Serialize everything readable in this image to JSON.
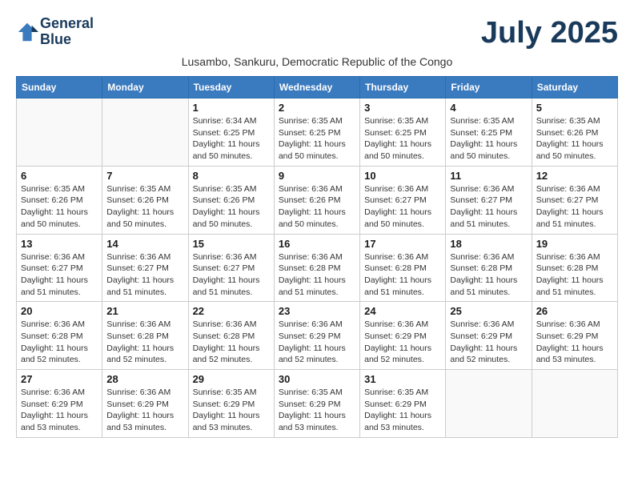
{
  "header": {
    "logo_line1": "General",
    "logo_line2": "Blue",
    "month_title": "July 2025",
    "subtitle": "Lusambo, Sankuru, Democratic Republic of the Congo"
  },
  "weekdays": [
    "Sunday",
    "Monday",
    "Tuesday",
    "Wednesday",
    "Thursday",
    "Friday",
    "Saturday"
  ],
  "weeks": [
    [
      {
        "day": "",
        "info": ""
      },
      {
        "day": "",
        "info": ""
      },
      {
        "day": "1",
        "info": "Sunrise: 6:34 AM\nSunset: 6:25 PM\nDaylight: 11 hours and 50 minutes."
      },
      {
        "day": "2",
        "info": "Sunrise: 6:35 AM\nSunset: 6:25 PM\nDaylight: 11 hours and 50 minutes."
      },
      {
        "day": "3",
        "info": "Sunrise: 6:35 AM\nSunset: 6:25 PM\nDaylight: 11 hours and 50 minutes."
      },
      {
        "day": "4",
        "info": "Sunrise: 6:35 AM\nSunset: 6:25 PM\nDaylight: 11 hours and 50 minutes."
      },
      {
        "day": "5",
        "info": "Sunrise: 6:35 AM\nSunset: 6:26 PM\nDaylight: 11 hours and 50 minutes."
      }
    ],
    [
      {
        "day": "6",
        "info": "Sunrise: 6:35 AM\nSunset: 6:26 PM\nDaylight: 11 hours and 50 minutes."
      },
      {
        "day": "7",
        "info": "Sunrise: 6:35 AM\nSunset: 6:26 PM\nDaylight: 11 hours and 50 minutes."
      },
      {
        "day": "8",
        "info": "Sunrise: 6:35 AM\nSunset: 6:26 PM\nDaylight: 11 hours and 50 minutes."
      },
      {
        "day": "9",
        "info": "Sunrise: 6:36 AM\nSunset: 6:26 PM\nDaylight: 11 hours and 50 minutes."
      },
      {
        "day": "10",
        "info": "Sunrise: 6:36 AM\nSunset: 6:27 PM\nDaylight: 11 hours and 50 minutes."
      },
      {
        "day": "11",
        "info": "Sunrise: 6:36 AM\nSunset: 6:27 PM\nDaylight: 11 hours and 51 minutes."
      },
      {
        "day": "12",
        "info": "Sunrise: 6:36 AM\nSunset: 6:27 PM\nDaylight: 11 hours and 51 minutes."
      }
    ],
    [
      {
        "day": "13",
        "info": "Sunrise: 6:36 AM\nSunset: 6:27 PM\nDaylight: 11 hours and 51 minutes."
      },
      {
        "day": "14",
        "info": "Sunrise: 6:36 AM\nSunset: 6:27 PM\nDaylight: 11 hours and 51 minutes."
      },
      {
        "day": "15",
        "info": "Sunrise: 6:36 AM\nSunset: 6:27 PM\nDaylight: 11 hours and 51 minutes."
      },
      {
        "day": "16",
        "info": "Sunrise: 6:36 AM\nSunset: 6:28 PM\nDaylight: 11 hours and 51 minutes."
      },
      {
        "day": "17",
        "info": "Sunrise: 6:36 AM\nSunset: 6:28 PM\nDaylight: 11 hours and 51 minutes."
      },
      {
        "day": "18",
        "info": "Sunrise: 6:36 AM\nSunset: 6:28 PM\nDaylight: 11 hours and 51 minutes."
      },
      {
        "day": "19",
        "info": "Sunrise: 6:36 AM\nSunset: 6:28 PM\nDaylight: 11 hours and 51 minutes."
      }
    ],
    [
      {
        "day": "20",
        "info": "Sunrise: 6:36 AM\nSunset: 6:28 PM\nDaylight: 11 hours and 52 minutes."
      },
      {
        "day": "21",
        "info": "Sunrise: 6:36 AM\nSunset: 6:28 PM\nDaylight: 11 hours and 52 minutes."
      },
      {
        "day": "22",
        "info": "Sunrise: 6:36 AM\nSunset: 6:28 PM\nDaylight: 11 hours and 52 minutes."
      },
      {
        "day": "23",
        "info": "Sunrise: 6:36 AM\nSunset: 6:29 PM\nDaylight: 11 hours and 52 minutes."
      },
      {
        "day": "24",
        "info": "Sunrise: 6:36 AM\nSunset: 6:29 PM\nDaylight: 11 hours and 52 minutes."
      },
      {
        "day": "25",
        "info": "Sunrise: 6:36 AM\nSunset: 6:29 PM\nDaylight: 11 hours and 52 minutes."
      },
      {
        "day": "26",
        "info": "Sunrise: 6:36 AM\nSunset: 6:29 PM\nDaylight: 11 hours and 53 minutes."
      }
    ],
    [
      {
        "day": "27",
        "info": "Sunrise: 6:36 AM\nSunset: 6:29 PM\nDaylight: 11 hours and 53 minutes."
      },
      {
        "day": "28",
        "info": "Sunrise: 6:36 AM\nSunset: 6:29 PM\nDaylight: 11 hours and 53 minutes."
      },
      {
        "day": "29",
        "info": "Sunrise: 6:35 AM\nSunset: 6:29 PM\nDaylight: 11 hours and 53 minutes."
      },
      {
        "day": "30",
        "info": "Sunrise: 6:35 AM\nSunset: 6:29 PM\nDaylight: 11 hours and 53 minutes."
      },
      {
        "day": "31",
        "info": "Sunrise: 6:35 AM\nSunset: 6:29 PM\nDaylight: 11 hours and 53 minutes."
      },
      {
        "day": "",
        "info": ""
      },
      {
        "day": "",
        "info": ""
      }
    ]
  ]
}
